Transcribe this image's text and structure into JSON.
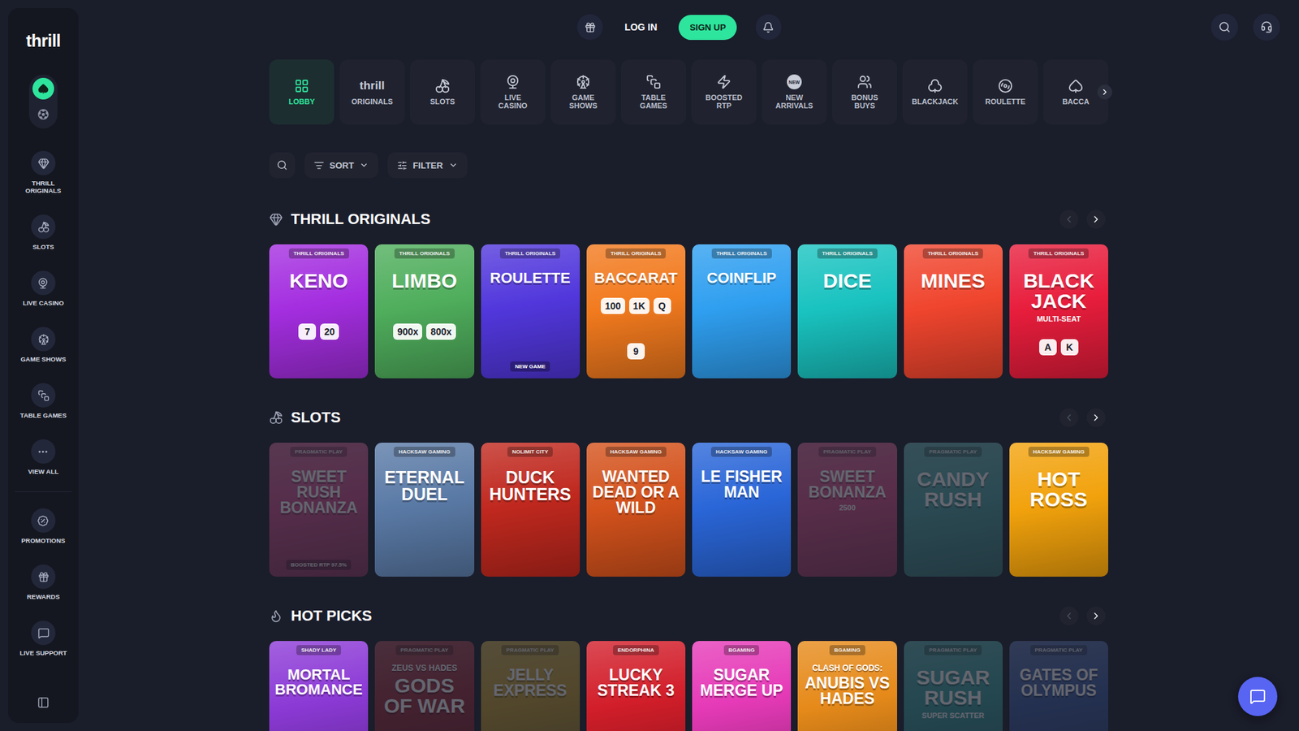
{
  "sidebar": {
    "logo": "thrill",
    "modes": [
      {
        "selected": true
      },
      {
        "selected": false
      }
    ],
    "groups": [
      [
        {
          "label": "THRILL ORIGINALS"
        },
        {
          "label": "SLOTS"
        },
        {
          "label": "LIVE CASINO"
        },
        {
          "label": "GAME SHOWS"
        },
        {
          "label": "TABLE GAMES"
        },
        {
          "label": "VIEW ALL"
        }
      ],
      [
        {
          "label": "PROMOTIONS"
        },
        {
          "label": "REWARDS"
        },
        {
          "label": "LIVE SUPPORT"
        }
      ]
    ]
  },
  "header": {
    "log_in": "LOG IN",
    "sign_up": "SIGN UP"
  },
  "categories": [
    {
      "label": "LOBBY",
      "selected": true
    },
    {
      "label": "ORIGINALS",
      "logo": "thrill",
      "selected": false
    },
    {
      "label": "SLOTS",
      "selected": false
    },
    {
      "label": "LIVE CASINO",
      "selected": false
    },
    {
      "label": "GAME SHOWS",
      "selected": false
    },
    {
      "label": "TABLE GAMES",
      "selected": false
    },
    {
      "label": "BOOSTED RTP",
      "selected": false
    },
    {
      "label": "NEW ARRIVALS",
      "badge": "NEW",
      "selected": false
    },
    {
      "label": "BONUS BUYS",
      "selected": false
    },
    {
      "label": "BLACKJACK",
      "selected": false
    },
    {
      "label": "ROULETTE",
      "selected": false
    },
    {
      "label": "BACCA",
      "selected": false
    }
  ],
  "toolbar": {
    "sort": "SORT",
    "filter": "FILTER"
  },
  "sections": [
    {
      "title": "THRILL ORIGINALS",
      "can_prev": false,
      "can_next": true,
      "games": [
        {
          "title": "KENO",
          "provider": "THRILL ORIGINALS",
          "color": "#a42ee0",
          "dimmed": false,
          "art": [
            "7",
            "20"
          ]
        },
        {
          "title": "LIMBO",
          "provider": "THRILL ORIGINALS",
          "color": "#4fae5c",
          "dimmed": false,
          "art": [
            "900x",
            "800x"
          ]
        },
        {
          "title": "ROULETTE",
          "provider": "THRILL ORIGINALS",
          "color": "#5137dc",
          "dimmed": false,
          "tag": "NEW GAME"
        },
        {
          "title": "BACCARAT",
          "provider": "THRILL ORIGINALS",
          "color": "#f27a1e",
          "dimmed": false,
          "art": [
            "100",
            "1K",
            "Q",
            "9"
          ]
        },
        {
          "title": "COINFLIP",
          "provider": "THRILL ORIGINALS",
          "color": "#2f9ff0",
          "dimmed": false
        },
        {
          "title": "DICE",
          "provider": "THRILL ORIGINALS",
          "color": "#19c3c0",
          "dimmed": false
        },
        {
          "title": "MINES",
          "provider": "THRILL ORIGINALS",
          "color": "#f0452e",
          "dimmed": false
        },
        {
          "title": "BLACK JACK",
          "provider": "THRILL ORIGINALS",
          "color": "#e81d3c",
          "dimmed": false,
          "sub": "MULTI-SEAT",
          "art": [
            "A",
            "K"
          ]
        }
      ]
    },
    {
      "title": "SLOTS",
      "can_prev": false,
      "can_next": true,
      "games": [
        {
          "title": "SWEET RUSH BONANZA",
          "provider": "PRAGMATIC PLAY",
          "color": "#d24f8e",
          "dimmed": true,
          "tag": "BOOSTED RTP 97.5%"
        },
        {
          "title": "ETERNAL DUEL",
          "provider": "HACKSAW GAMING",
          "color": "#5a7aa6",
          "dimmed": false
        },
        {
          "title": "DUCK HUNTERS",
          "provider": "NOLIMIT CITY",
          "color": "#c0281e",
          "dimmed": false
        },
        {
          "title": "WANTED DEAD OR A WILD",
          "provider": "HACKSAW GAMING",
          "color": "#d4521c",
          "dimmed": false
        },
        {
          "title": "LE FISHER MAN",
          "provider": "HACKSAW GAMING",
          "color": "#2a66d8",
          "dimmed": false
        },
        {
          "title": "SWEET BONANZA",
          "provider": "PRAGMATIC PLAY",
          "color": "#d94f8a",
          "dimmed": true,
          "sub": "2500"
        },
        {
          "title": "CANDY RUSH",
          "provider": "PRAGMATIC PLAY",
          "color": "#4fa8a8",
          "dimmed": true
        },
        {
          "title": "HOT ROSS",
          "provider": "HACKSAW GAMING",
          "color": "#f2a20c",
          "dimmed": false
        }
      ]
    },
    {
      "title": "HOT PICKS",
      "can_prev": false,
      "can_next": true,
      "games": [
        {
          "title": "MORTAL BROMANCE",
          "provider": "SHADY LADY",
          "color": "#8c3ad6",
          "dimmed": false
        },
        {
          "title": "GODS OF WAR",
          "kicker": "ZEUS VS HADES",
          "provider": "PRAGMATIC PLAY",
          "color": "#9c2a3a",
          "dimmed": true
        },
        {
          "title": "JELLY EXPRESS",
          "provider": "PRAGMATIC PLAY",
          "color": "#c8a030",
          "dimmed": true
        },
        {
          "title": "LUCKY STREAK 3",
          "provider": "ENDORPHINA",
          "color": "#d21e2a",
          "dimmed": false
        },
        {
          "title": "SUGAR MERGE UP",
          "provider": "BGAMING",
          "color": "#e63ab8",
          "dimmed": false
        },
        {
          "title": "ANUBIS VS HADES",
          "kicker": "CLASH OF GODS:",
          "provider": "BGAMING",
          "color": "#e68a1a",
          "dimmed": false
        },
        {
          "title": "SUGAR RUSH",
          "provider": "PRAGMATIC PLAY",
          "color": "#3aa0a0",
          "dimmed": true,
          "sub": "SUPER SCATTER"
        },
        {
          "title": "GATES OF OLYMPUS",
          "provider": "PRAGMATIC PLAY",
          "color": "#3a5aa0",
          "dimmed": true
        }
      ]
    }
  ]
}
